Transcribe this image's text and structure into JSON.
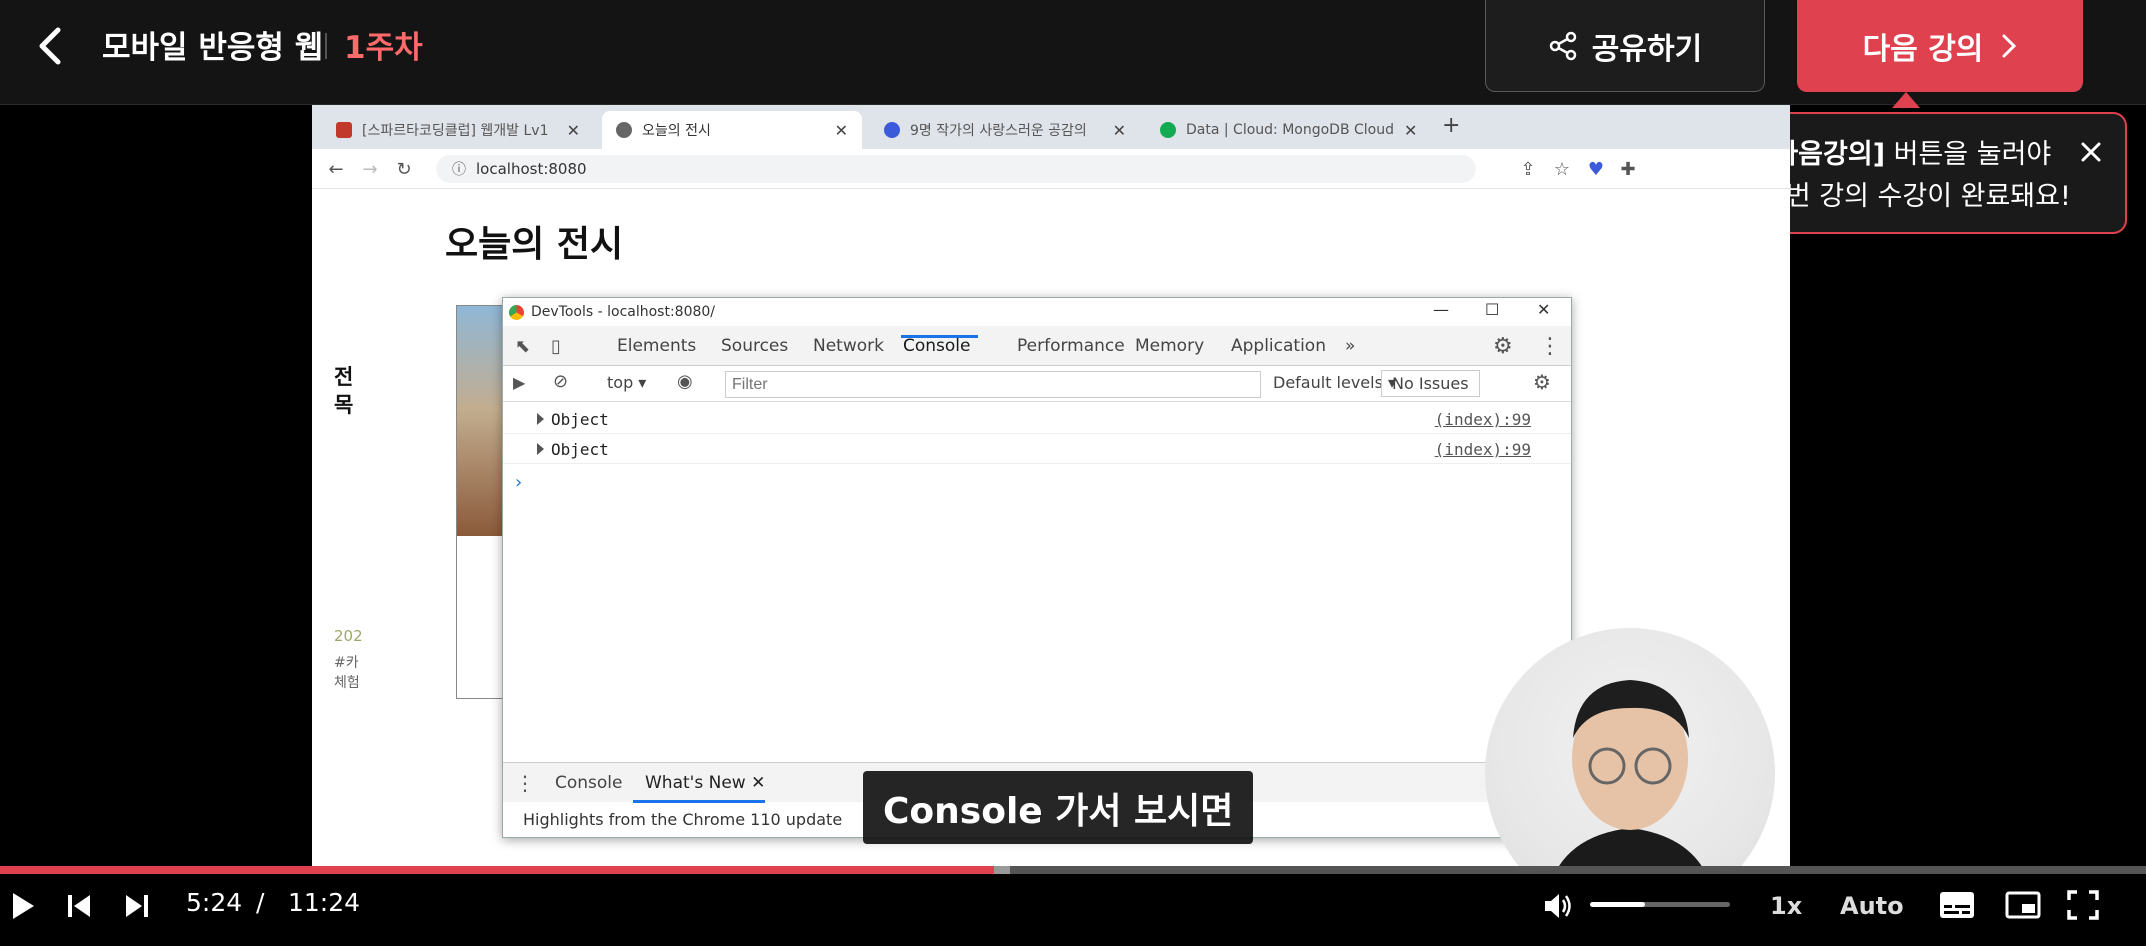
{
  "header": {
    "course_title": "모바일 반응형 웹",
    "week": "1주차",
    "share_label": "공유하기",
    "next_label": "다음 강의"
  },
  "tooltip": {
    "bold": "[다음강의]",
    "line1_rest": " 버튼을 눌러야",
    "line2": "이번 강의 수강이 완료돼요!"
  },
  "browser": {
    "tabs": [
      {
        "label": "[스파르타코딩클럽] 웹개발 Lv1"
      },
      {
        "label": "오늘의 전시"
      },
      {
        "label": "9명 작가의 사랑스러운 공감의"
      },
      {
        "label": "Data | Cloud: MongoDB Cloud"
      }
    ],
    "address": "localhost:8080"
  },
  "page": {
    "heading": "오늘의 전시",
    "card_title": "전\n목",
    "card_date": "202",
    "card_tag": "#카\n체험"
  },
  "devtools": {
    "title": "DevTools - localhost:8080/",
    "tabs": [
      "Elements",
      "Sources",
      "Network",
      "Console",
      "Performance",
      "Memory",
      "Application"
    ],
    "context": "top",
    "filter_placeholder": "Filter",
    "levels": "Default levels",
    "issues": "No Issues",
    "rows": [
      {
        "label": "Object",
        "source": "(index):99"
      },
      {
        "label": "Object",
        "source": "(index):99"
      }
    ],
    "drawer_tabs": [
      "Console",
      "What's New"
    ],
    "drawer_text": "Highlights from the Chrome 110 update"
  },
  "subtitle": "Console 가서 보시면",
  "player": {
    "current_time": "5:24",
    "separator": "/",
    "total_time": "11:24",
    "progress": 0.4632,
    "volume": 0.39,
    "speed": "1x",
    "quality": "Auto"
  },
  "colors": {
    "accent": "#e0414f",
    "week": "#ff6b6b",
    "header_bg": "#141414"
  }
}
